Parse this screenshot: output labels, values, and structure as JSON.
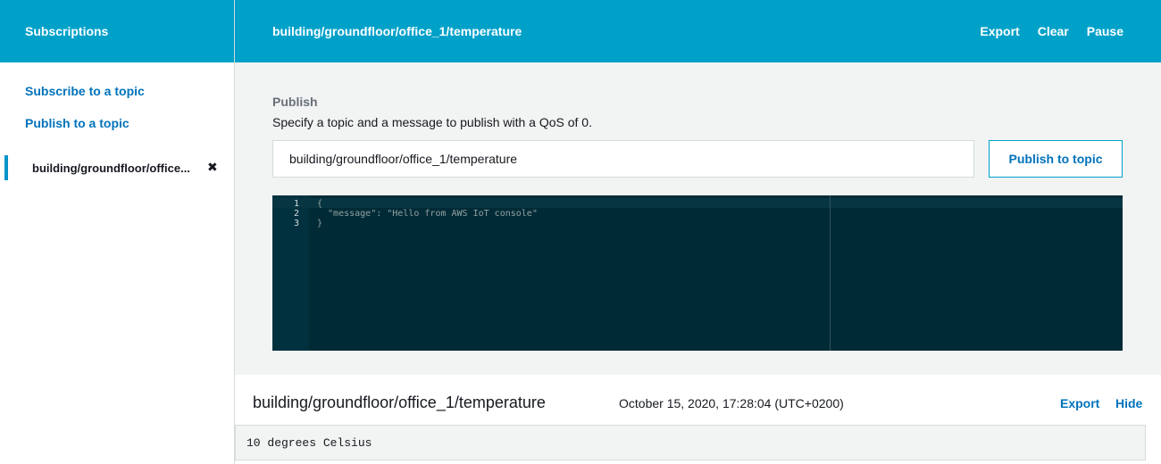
{
  "sidebar": {
    "header": "Subscriptions",
    "links": [
      "Subscribe to a topic",
      "Publish to a topic"
    ],
    "active_topic": "building/groundfloor/office...",
    "close_glyph": "✖"
  },
  "header": {
    "title": "building/groundfloor/office_1/temperature",
    "actions": [
      "Export",
      "Clear",
      "Pause"
    ]
  },
  "publish": {
    "heading": "Publish",
    "description": "Specify a topic and a message to publish with a QoS of 0.",
    "topic_value": "building/groundfloor/office_1/temperature",
    "button_label": "Publish to topic",
    "editor": {
      "line_numbers": [
        "1",
        "2",
        "3"
      ],
      "lines": [
        "{",
        "  \"message\": \"Hello from AWS IoT console\"",
        "}"
      ]
    }
  },
  "message": {
    "topic": "building/groundfloor/office_1/temperature",
    "timestamp": "October 15, 2020, 17:28:04 (UTC+0200)",
    "export_label": "Export",
    "hide_label": "Hide",
    "payload": "10 degrees Celsius"
  },
  "colors": {
    "header_bg": "#00a1c9",
    "link": "#0073bb",
    "editor_bg": "#002b36"
  }
}
